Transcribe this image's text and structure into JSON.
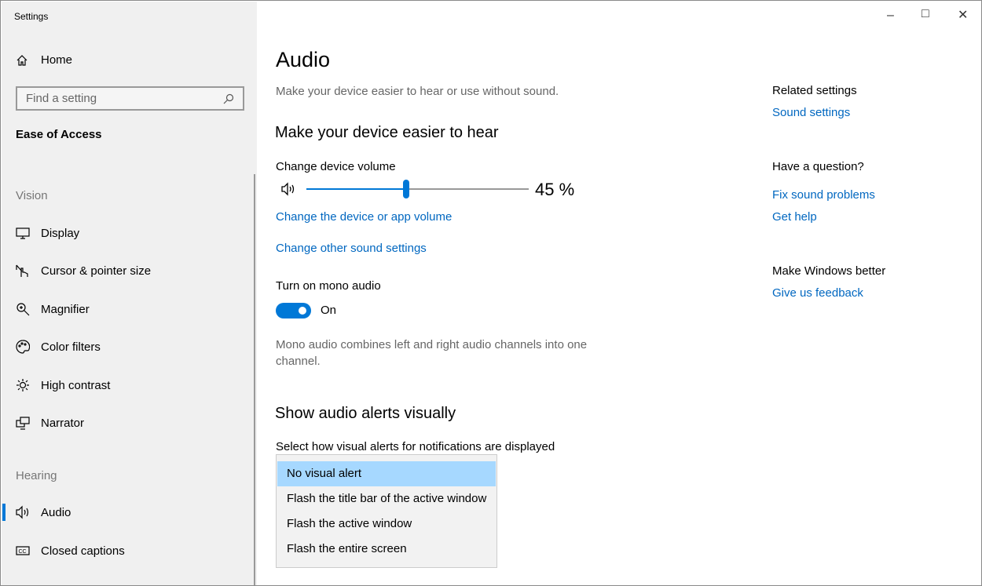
{
  "window": {
    "title": "Settings",
    "controls": [
      "minimize",
      "maximize",
      "close"
    ]
  },
  "sidebar": {
    "home": "Home",
    "search_placeholder": "Find a setting",
    "category": "Ease of Access",
    "groups": [
      {
        "label": "Vision",
        "items": [
          {
            "label": "Display",
            "icon": "display-icon"
          },
          {
            "label": "Cursor & pointer size",
            "icon": "cursor-icon"
          },
          {
            "label": "Magnifier",
            "icon": "magnifier-icon"
          },
          {
            "label": "Color filters",
            "icon": "palette-icon"
          },
          {
            "label": "High contrast",
            "icon": "sun-icon"
          },
          {
            "label": "Narrator",
            "icon": "narrator-icon"
          }
        ]
      },
      {
        "label": "Hearing",
        "items": [
          {
            "label": "Audio",
            "icon": "speaker-icon",
            "selected": true
          },
          {
            "label": "Closed captions",
            "icon": "cc-icon"
          }
        ]
      }
    ]
  },
  "main": {
    "title": "Audio",
    "subtitle": "Make your device easier to hear or use without sound.",
    "hear_heading": "Make your device easier to hear",
    "volume_label": "Change device volume",
    "volume_value": 45,
    "volume_text": "45 %",
    "link_app_volume": "Change the device or app volume",
    "link_other_sound": "Change other sound settings",
    "mono_label": "Turn on mono audio",
    "mono_state": "On",
    "mono_desc": "Mono audio combines left and right audio channels into one channel.",
    "alerts_heading": "Show audio alerts visually",
    "alerts_label": "Select how visual alerts for notifications are displayed",
    "alert_options": [
      "No visual alert",
      "Flash the title bar of the active window",
      "Flash the active window",
      "Flash the entire screen"
    ],
    "alert_selected": "No visual alert"
  },
  "related": {
    "heading": "Related settings",
    "sound_settings": "Sound settings",
    "question_heading": "Have a question?",
    "fix_sound": "Fix sound problems",
    "get_help": "Get help",
    "better_heading": "Make Windows better",
    "feedback": "Give us feedback"
  },
  "colors": {
    "accent": "#0078d7",
    "link": "#0067c0",
    "selected_option": "#a6d8ff"
  }
}
